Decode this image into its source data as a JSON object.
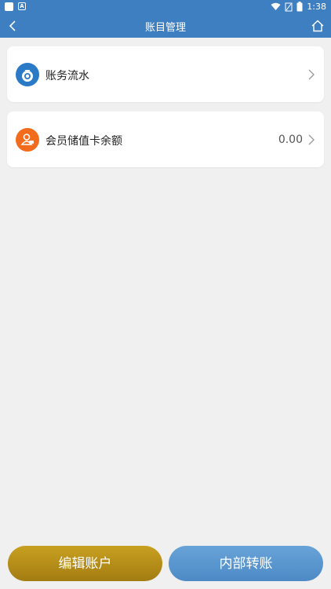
{
  "status_bar": {
    "time": "1:38",
    "left_icons": [
      "app-icon",
      "a-badge-icon"
    ],
    "right_icons": [
      "wifi-icon",
      "no-signal-icon",
      "battery-icon"
    ]
  },
  "nav": {
    "title": "账目管理",
    "back_icon": "chevron-left-icon",
    "home_icon": "home-icon",
    "bg_color": "#3d7fc1"
  },
  "cards": [
    {
      "label": "账务流水",
      "value": "",
      "icon": "money-bag-icon",
      "icon_color": "#2b7ac7"
    },
    {
      "label": "会员储值卡余额",
      "value": "0.00",
      "icon": "member-icon",
      "icon_color": "#f36b1c"
    }
  ],
  "buttons": {
    "edit_account": "编辑账户",
    "internal_transfer": "内部转账",
    "edit_color": "#b8901a",
    "transfer_color": "#5b97cf"
  }
}
